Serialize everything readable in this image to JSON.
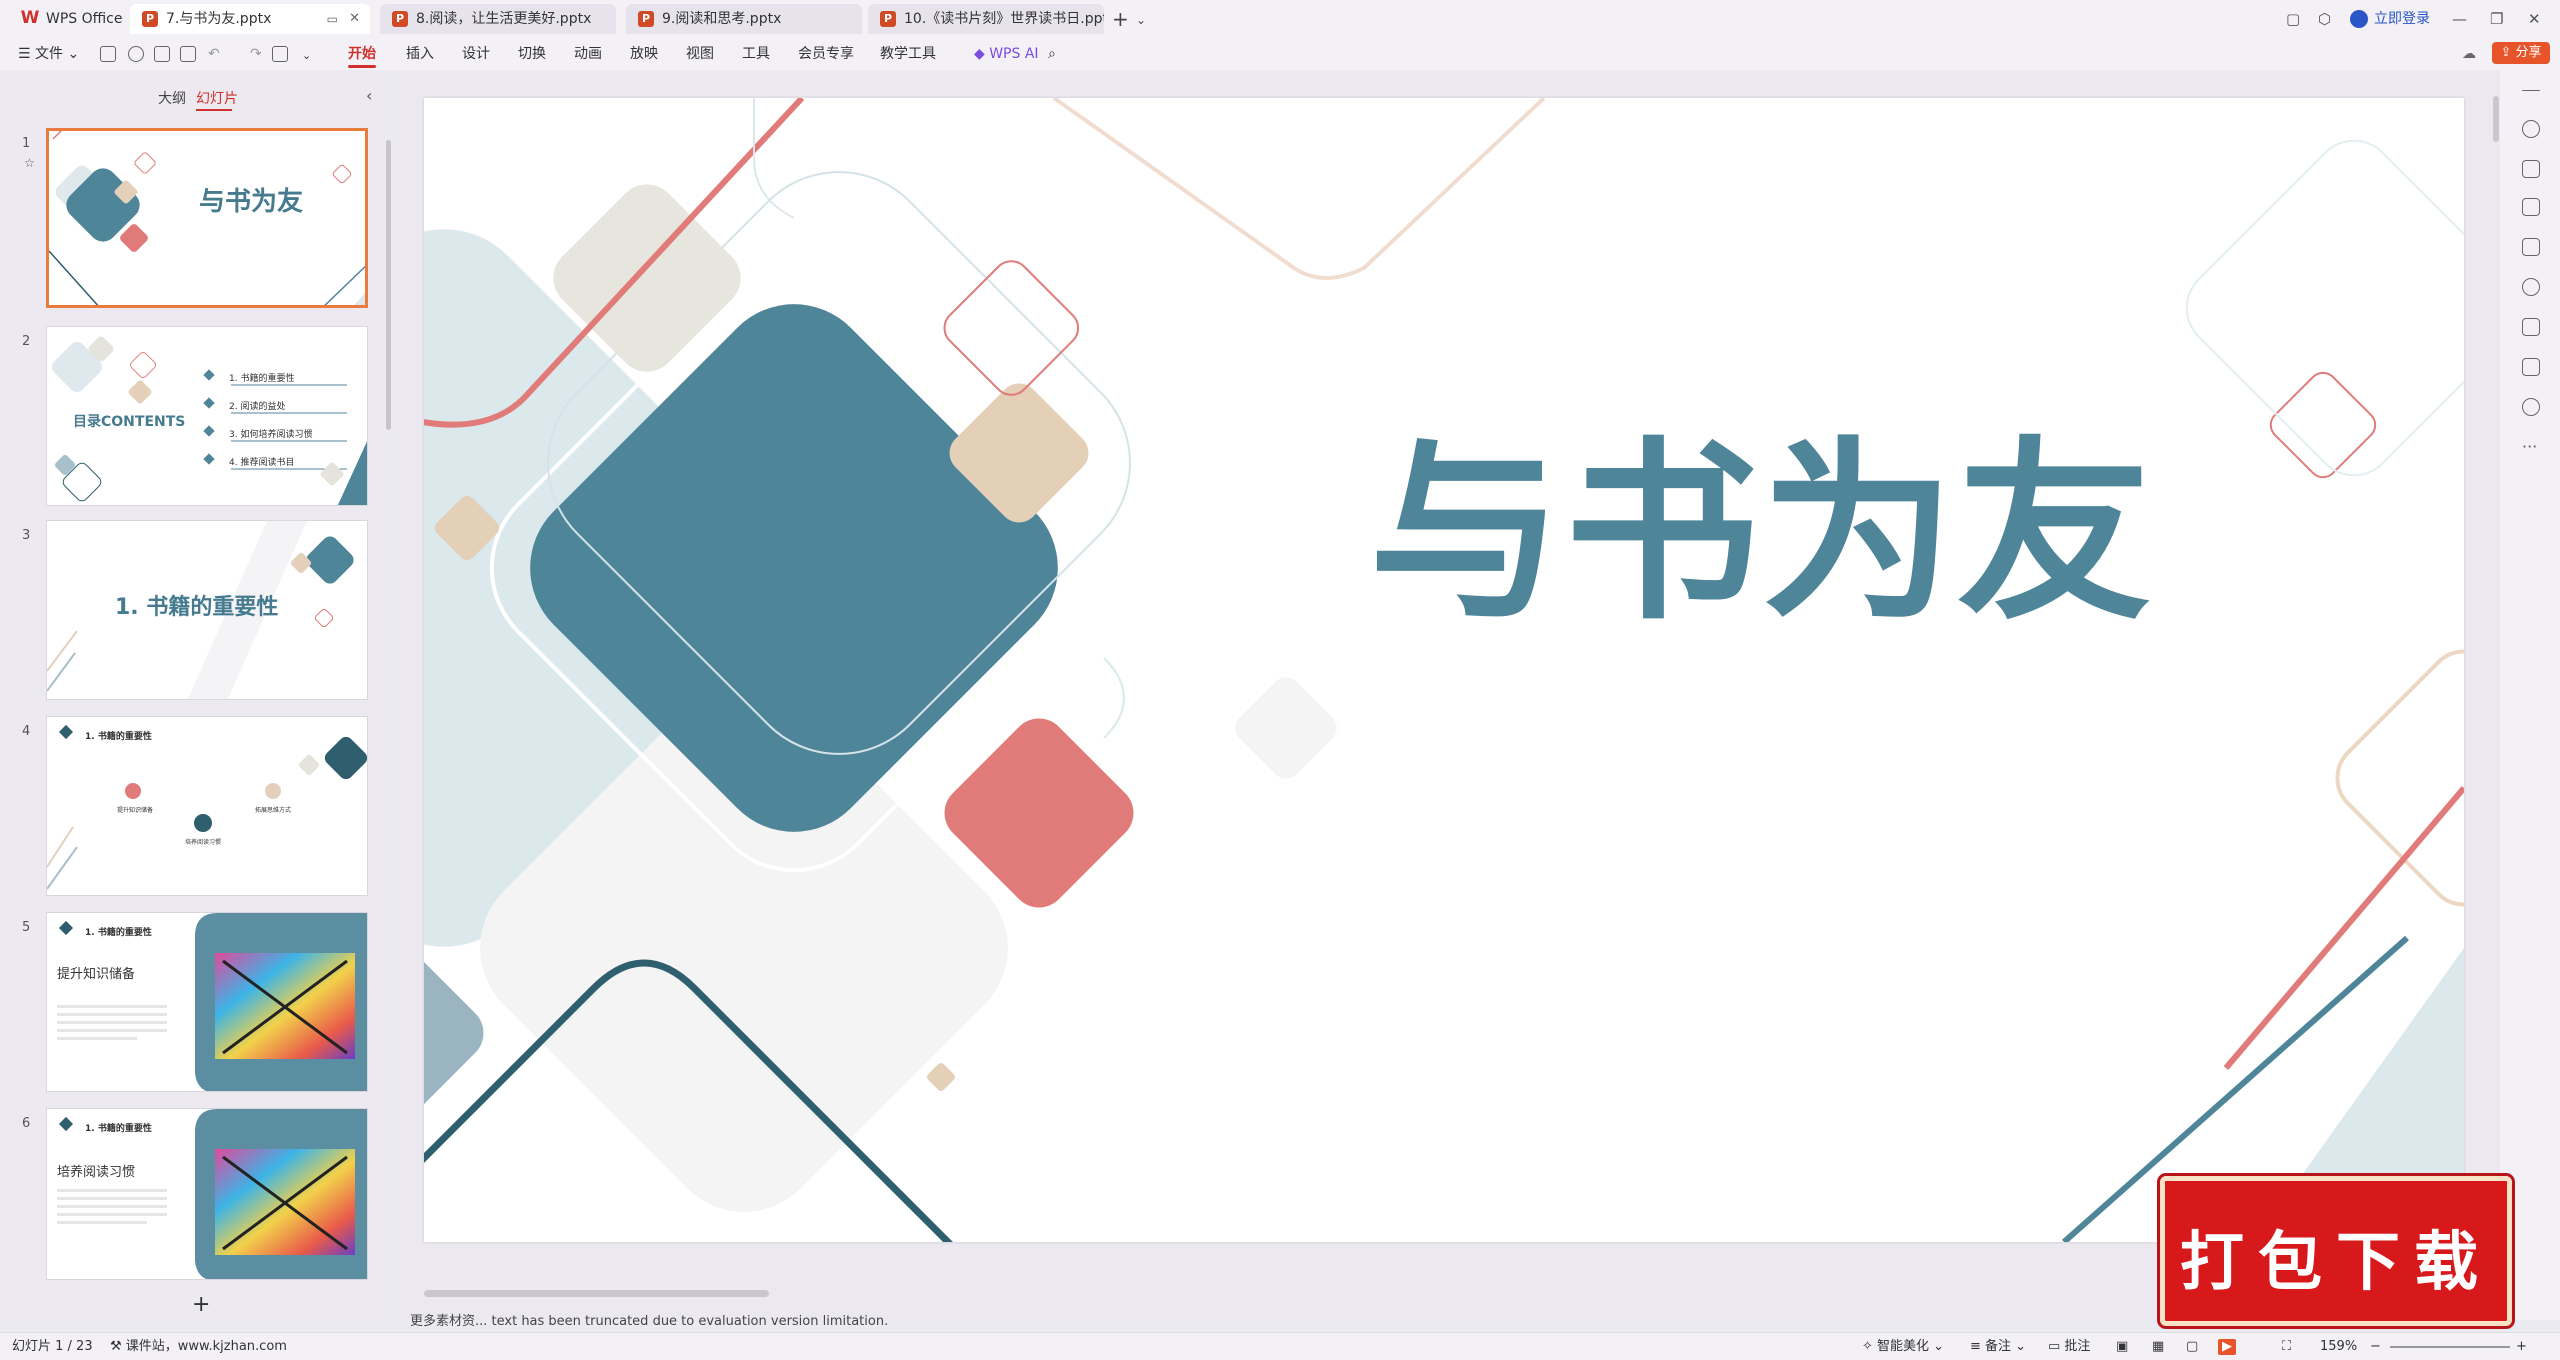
{
  "app": {
    "name": "WPS Office"
  },
  "tabs": [
    {
      "label": "7.与书为友.pptx",
      "active": true
    },
    {
      "label": "8.阅读，让生活更美好.pptx",
      "active": false
    },
    {
      "label": "9.阅读和思考.pptx",
      "active": false
    },
    {
      "label": "10.《读书片刻》世界读书日.pptx",
      "active": false
    }
  ],
  "titlebar": {
    "login": "立即登录",
    "share": "分享"
  },
  "ribbon": {
    "file_menu": "文件",
    "items": [
      "开始",
      "插入",
      "设计",
      "切换",
      "动画",
      "放映",
      "视图",
      "工具",
      "会员专享",
      "教学工具"
    ],
    "active": "开始",
    "ai": "WPS AI"
  },
  "leftpanel": {
    "outline_tab": "大纲",
    "slides_tab": "幻灯片",
    "add": "+"
  },
  "thumbnails": [
    {
      "num": "1",
      "title": "与书为友"
    },
    {
      "num": "2",
      "title": "目录CONTENTS",
      "items": [
        "1. 书籍的重要性",
        "2. 阅读的益处",
        "3. 如何培养阅读习惯",
        "4. 推荐阅读书目"
      ]
    },
    {
      "num": "3",
      "title": "1. 书籍的重要性"
    },
    {
      "num": "4",
      "header": "1. 书籍的重要性",
      "nodes": [
        "提升知识储备",
        "培养阅读习惯",
        "拓展思维方式"
      ]
    },
    {
      "num": "5",
      "header": "1. 书籍的重要性",
      "subtitle": "提升知识储备"
    },
    {
      "num": "6",
      "header": "1. 书籍的重要性",
      "subtitle": "培养阅读习惯"
    }
  ],
  "slide": {
    "title": "与书为友"
  },
  "notes": "更多素材资... text has been truncated due to evaluation version limitation.",
  "status": {
    "slide_counter": "幻灯片 1 / 23",
    "site": "课件站，www.kjzhan.com",
    "beautify": "智能美化",
    "notes_btn": "备注",
    "comments": "批注",
    "zoom": "159%"
  },
  "watermark": "打包下载",
  "colors": {
    "accent": "#d0312d",
    "title_blue": "#4f8599",
    "share": "#e8542a"
  }
}
